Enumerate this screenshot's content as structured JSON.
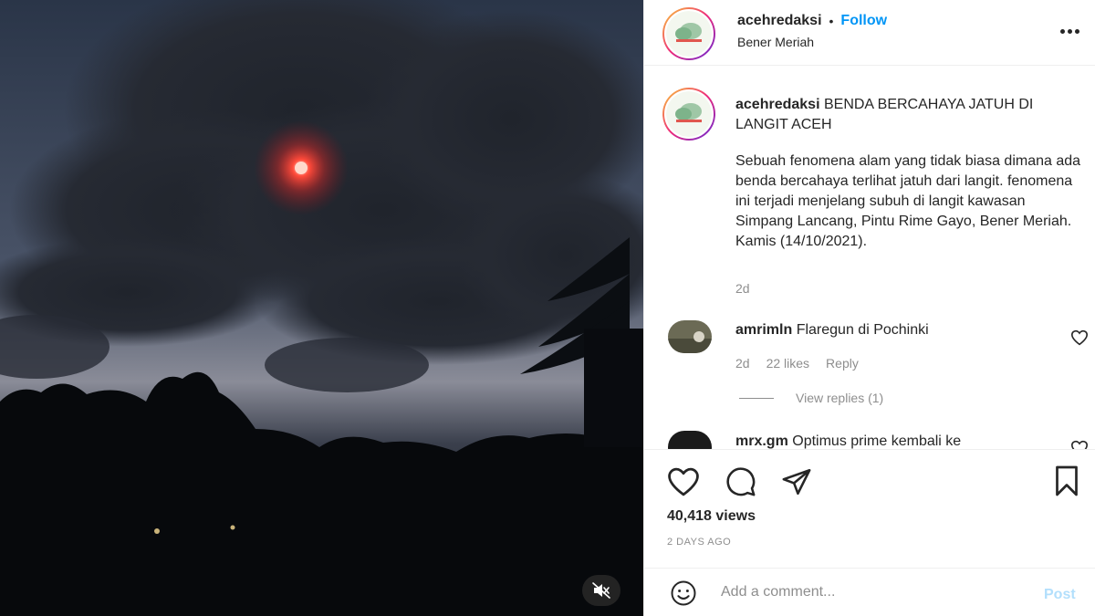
{
  "header": {
    "username": "acehredaksi",
    "dot": "•",
    "follow_label": "Follow",
    "location": "Bener Meriah",
    "more_icon": "more-options-icon"
  },
  "caption": {
    "username": "acehredaksi",
    "title": "BENDA BERCAHAYA JATUH DI LANGIT ACEH",
    "body": "Sebuah fenomena alam yang tidak biasa dimana ada benda bercahaya terlihat jatuh dari langit. fenomena ini terjadi menjelang subuh di langit kawasan Simpang Lancang, Pintu Rime Gayo, Bener Meriah. Kamis (14/10/2021).",
    "time": "2d"
  },
  "comments": [
    {
      "username": "amrimln",
      "text": "Flaregun di Pochinki",
      "time": "2d",
      "likes": "22 likes",
      "reply_label": "Reply",
      "view_replies": "View replies (1)"
    },
    {
      "username": "mrx.gm",
      "text": "Optimus prime kembali ke"
    }
  ],
  "actions": {
    "like_icon": "heart-icon",
    "comment_icon": "comment-icon",
    "share_icon": "paper-plane-icon",
    "save_icon": "bookmark-icon",
    "views": "40,418 views",
    "posted": "2 DAYS AGO"
  },
  "add_comment": {
    "placeholder": "Add a comment...",
    "post_label": "Post",
    "emoji_icon": "emoji-icon"
  },
  "media": {
    "mute_icon": "muted-speaker-icon"
  },
  "colors": {
    "follow_blue": "#0095f6",
    "post_disabled_blue": "#b2dffc",
    "secondary_text": "#8e8e8e",
    "glow_red": "#ff3b2f"
  }
}
